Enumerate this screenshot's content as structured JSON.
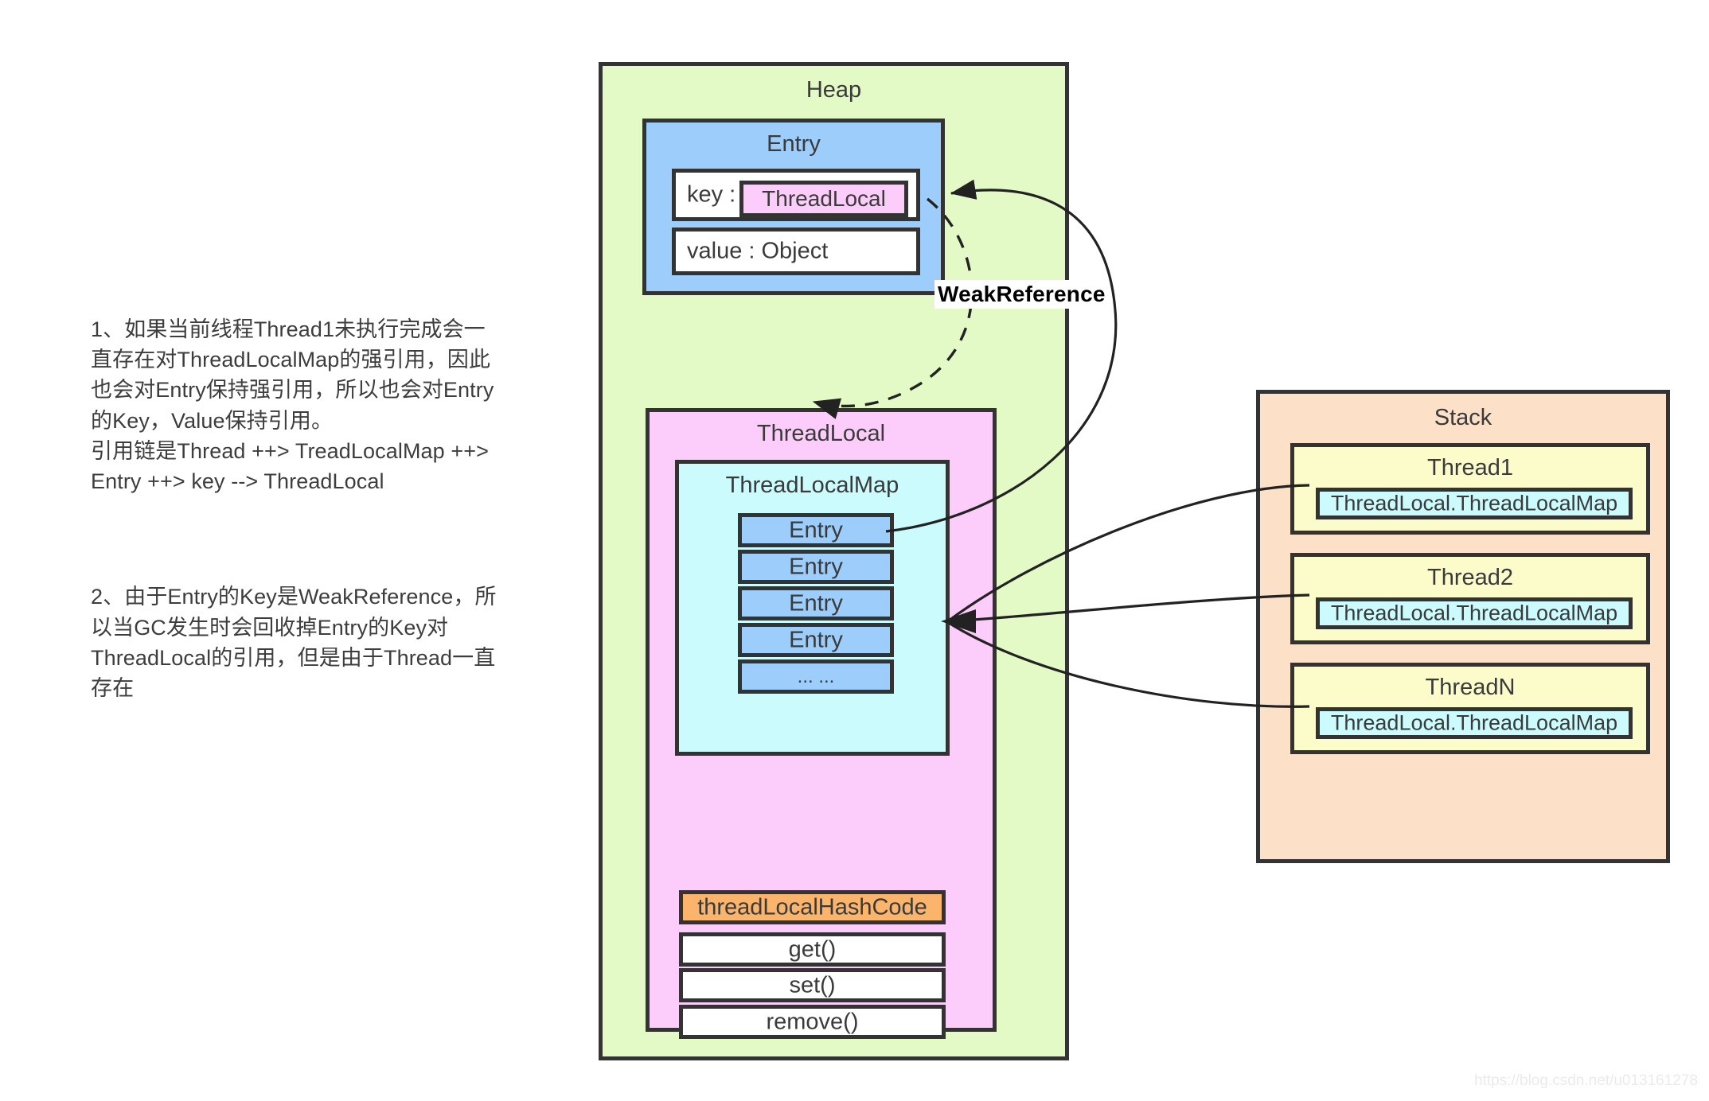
{
  "notes": {
    "paragraph_1": "1、如果当前线程Thread1未执行完成会一直存在对ThreadLocalMap的强引用，因此也会对Entry保持强引用，所以也会对Entry的Key，Value保持引用。\n引用链是Thread ++> TreadLocalMap ++> Entry ++> key --> ThreadLocal",
    "paragraph_2": "2、由于Entry的Key是WeakReference，所以当GC发生时会回收掉Entry的Key对ThreadLocal的引用，但是由于Thread一直存在"
  },
  "heap": {
    "title": "Heap",
    "entry_block": {
      "title": "Entry",
      "key_label": "key :",
      "key_value": "ThreadLocal",
      "value_row": "value : Object"
    },
    "threadlocal_block": {
      "title": "ThreadLocal",
      "threadlocalmap": {
        "title": "ThreadLocalMap",
        "entries": [
          "Entry",
          "Entry",
          "Entry",
          "Entry",
          "... ..."
        ]
      },
      "field": "threadLocalHashCode",
      "methods": [
        "get()",
        "set()",
        "remove()"
      ]
    }
  },
  "stack": {
    "title": "Stack",
    "threads": [
      {
        "name": "Thread1",
        "map_ref": "ThreadLocal.ThreadLocalMap"
      },
      {
        "name": "Thread2",
        "map_ref": "ThreadLocal.ThreadLocalMap"
      },
      {
        "name": "ThreadN",
        "map_ref": "ThreadLocal.ThreadLocalMap"
      }
    ]
  },
  "annotations": {
    "weak_reference": "WeakReference"
  },
  "watermark": "https://blog.csdn.net/u013161278",
  "colors": {
    "heap_fill": "#e3fac6",
    "entry_fill": "#9ccdfb",
    "threadlocal_fill": "#fccdfa",
    "threadlocalmap_fill": "#cbfbfd",
    "stack_fill": "#fde0c8",
    "thread_fill": "#fcfccb",
    "hashcode_fill": "#fbb46b",
    "stroke": "#333333"
  }
}
